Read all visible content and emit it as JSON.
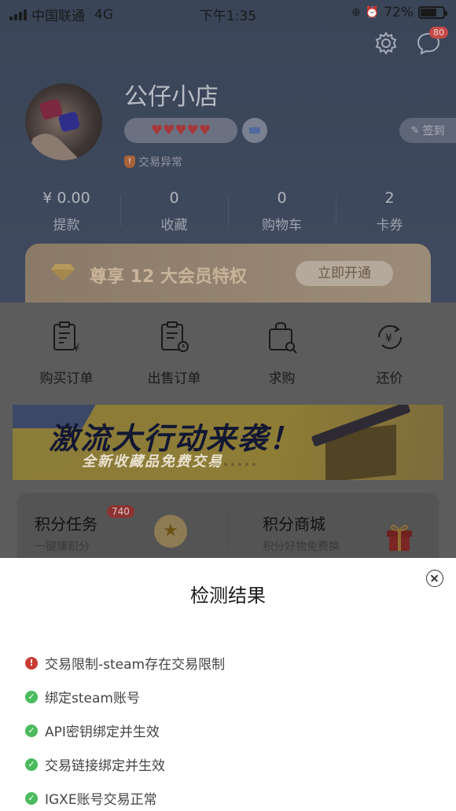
{
  "status_bar": {
    "carrier": "中国联通",
    "network": "4G",
    "time": "下午1:35",
    "battery_percent": "72%",
    "battery_level": 0.72
  },
  "header": {
    "message_badge": "80",
    "shop_name": "公仔小店",
    "hearts": "♥♥♥♥♥",
    "trade_status": "交易异常",
    "checkin_label": "签到"
  },
  "stats": [
    {
      "value": "¥ 0.00",
      "label": "提款"
    },
    {
      "value": "0",
      "label": "收藏"
    },
    {
      "value": "0",
      "label": "购物车"
    },
    {
      "value": "2",
      "label": "卡券"
    }
  ],
  "vip": {
    "text": "尊享 12 大会员特权",
    "button": "立即开通"
  },
  "quick_actions": [
    {
      "label": "购买订单",
      "icon": "purchase-order-icon"
    },
    {
      "label": "出售订单",
      "icon": "sell-order-icon"
    },
    {
      "label": "求购",
      "icon": "want-to-buy-icon"
    },
    {
      "label": "还价",
      "icon": "counter-offer-icon"
    }
  ],
  "promo": {
    "title": "激流大行动来袭！",
    "subtitle": "全新收藏品免费交易"
  },
  "points": {
    "tasks_title": "积分任务",
    "tasks_badge": "740",
    "tasks_sub": "一键赚积分",
    "mall_title": "积分商城",
    "mall_sub": "积分好物免费换"
  },
  "modal": {
    "title": "检测结果",
    "results": [
      {
        "status": "error",
        "text": "交易限制-steam存在交易限制"
      },
      {
        "status": "ok",
        "text": "绑定steam账号"
      },
      {
        "status": "ok",
        "text": "API密钥绑定并生效"
      },
      {
        "status": "ok",
        "text": "交易链接绑定并生效"
      },
      {
        "status": "ok",
        "text": "IGXE账号交易正常"
      }
    ]
  },
  "colors": {
    "error": "#c83b33",
    "ok": "#4bbb5d"
  }
}
